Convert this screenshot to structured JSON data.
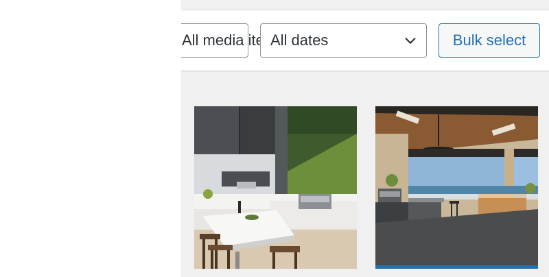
{
  "toolbar": {
    "media_type_filter": {
      "value": "All media items"
    },
    "date_filter": {
      "value": "All dates"
    },
    "bulk_select_label": "Bulk select"
  },
  "media_grid": {
    "items": [
      {
        "subject": "Outdoor kitchen with white table, stools and built-in grill"
      },
      {
        "subject": "Covered outdoor kitchen with ceiling fan overlooking the sea"
      }
    ]
  },
  "colors": {
    "accent": "#2271b1",
    "background": "#f0f0f1",
    "border": "#8c8f94"
  }
}
